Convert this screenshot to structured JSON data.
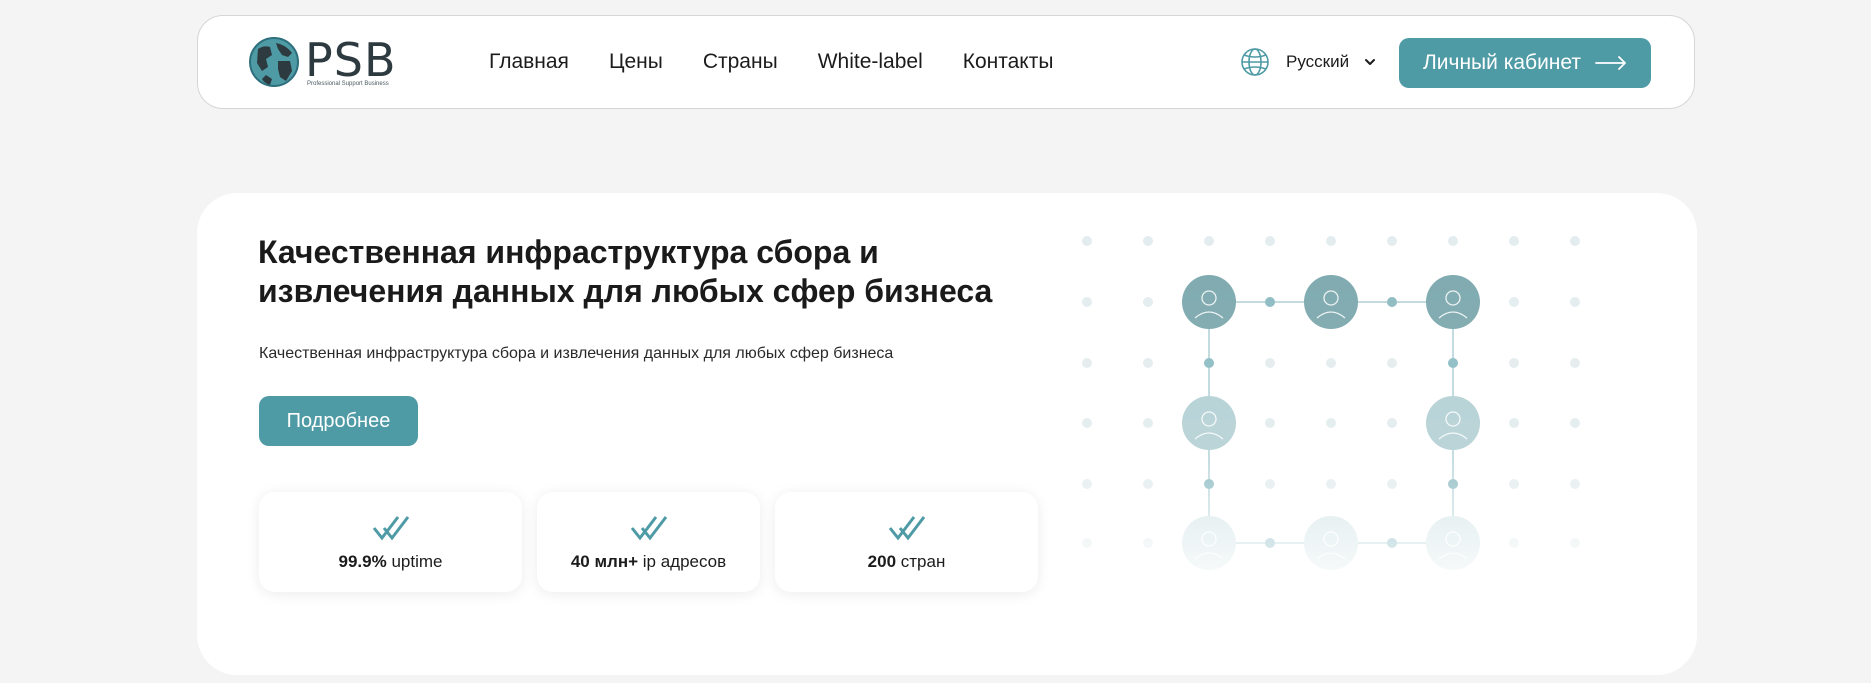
{
  "header": {
    "logo": {
      "brand": "PSB",
      "tagline": "Professional Support Business"
    },
    "nav": [
      "Главная",
      "Цены",
      "Страны",
      "White-label",
      "Контакты"
    ],
    "language": "Русский",
    "cabinet_label": "Личный кабинет"
  },
  "hero": {
    "title": "Качественная инфраструктура сбора и извлечения данных для любых сфер бизнеса",
    "subtitle": "Качественная инфраструктура сбора и извлечения данных для любых сфер бизнеса",
    "button_label": "Подробнее",
    "stats": [
      {
        "bold": "99.9%",
        "text": " uptime"
      },
      {
        "bold": "40 млн+",
        "text": " ip адресов"
      },
      {
        "bold": "200",
        "text": " стран"
      }
    ]
  },
  "colors": {
    "accent": "#4e9aa5",
    "page_bg": "#f4f4f4"
  },
  "icons": [
    "globe-logo-icon",
    "globe-icon",
    "chevron-down-icon",
    "arrow-right-icon",
    "double-check-icon",
    "user-avatar-icon"
  ]
}
